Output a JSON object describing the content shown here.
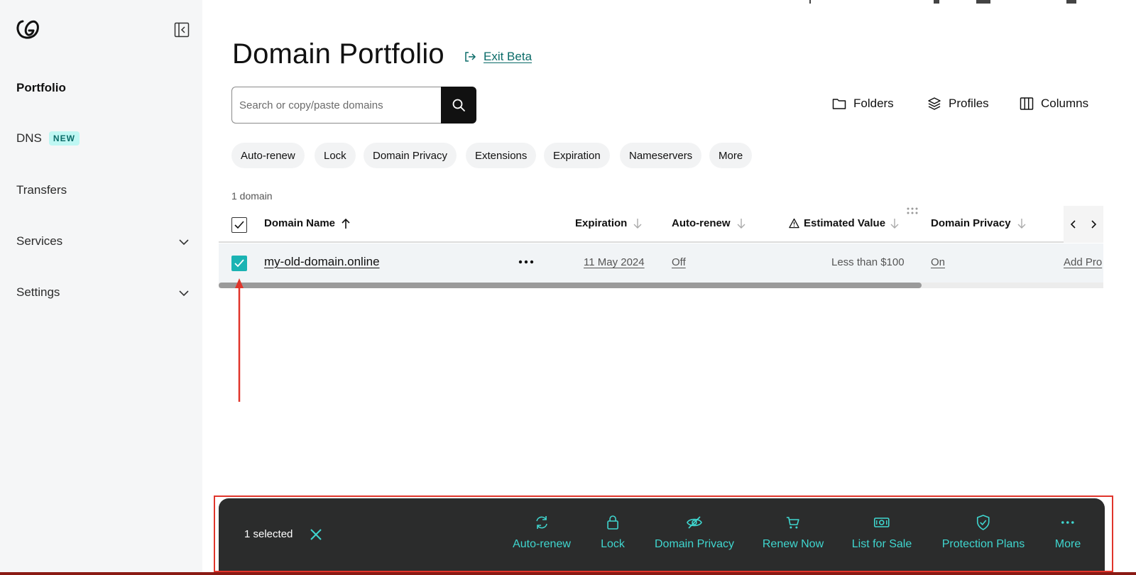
{
  "sidebar": {
    "items": [
      {
        "label": "Portfolio"
      },
      {
        "label": "DNS",
        "badge": "NEW"
      },
      {
        "label": "Transfers"
      },
      {
        "label": "Services"
      },
      {
        "label": "Settings"
      }
    ]
  },
  "header": {
    "title": "Domain Portfolio",
    "exit_beta": "Exit Beta"
  },
  "search": {
    "placeholder": "Search or copy/paste domains",
    "value": ""
  },
  "toolbar": {
    "folders": "Folders",
    "profiles": "Profiles",
    "columns": "Columns"
  },
  "filters": [
    "Auto-renew",
    "Lock",
    "Domain Privacy",
    "Extensions",
    "Expiration",
    "Nameservers",
    "More"
  ],
  "table": {
    "count": "1 domain",
    "headers": {
      "domain_name": "Domain Name",
      "expiration": "Expiration",
      "auto_renew": "Auto-renew",
      "estimated_value": "Estimated Value",
      "domain_privacy": "Domain Privacy"
    },
    "rows": [
      {
        "domain": "my-old-domain.online",
        "expiration": "11 May 2024",
        "auto_renew": "Off",
        "estimated_value": "Less than $100",
        "domain_privacy": "On",
        "protection": "Add Pro"
      }
    ]
  },
  "action_bar": {
    "selected": "1 selected",
    "actions": [
      "Auto-renew",
      "Lock",
      "Domain Privacy",
      "Renew Now",
      "List for Sale",
      "Protection Plans",
      "More"
    ]
  },
  "colors": {
    "accent": "#3fd6cf",
    "link": "#0a6b68",
    "checkbox": "#1bb3b3",
    "annotation": "#e0352b",
    "bar_bg": "#2b2c2c"
  }
}
